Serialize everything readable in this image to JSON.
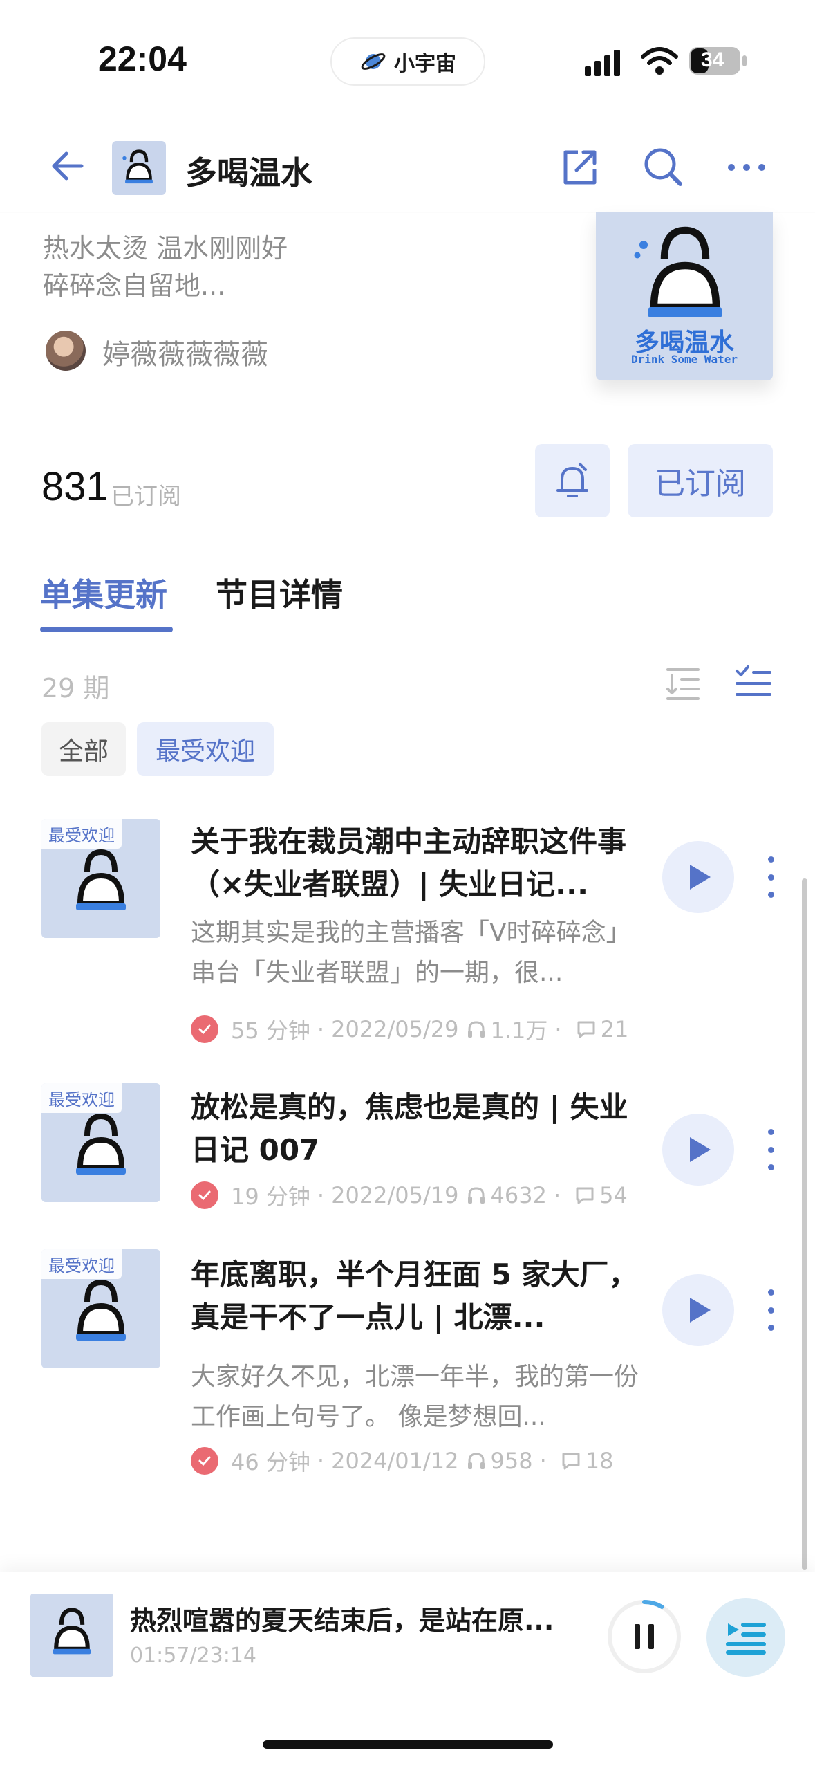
{
  "status_bar": {
    "time": "22:04",
    "app_pill_label": "小宇宙",
    "battery": "34"
  },
  "header": {
    "title": "多喝温水"
  },
  "podcast": {
    "description_lines": [
      "热水太烫 温水刚刚好",
      "碎碎念自留地..."
    ],
    "author": "婷薇薇薇薇薇",
    "cover_title": "多喝温水",
    "cover_subtitle": "Drink Some Water",
    "subscriber_count": "831",
    "subscriber_label": "已订阅",
    "subscribe_button": "已订阅"
  },
  "tabs": [
    {
      "label": "单集更新",
      "active": true
    },
    {
      "label": "节目详情",
      "active": false
    }
  ],
  "list": {
    "episode_count": "29 期",
    "filters": [
      {
        "label": "全部",
        "selected": false
      },
      {
        "label": "最受欢迎",
        "selected": true
      }
    ]
  },
  "episodes": [
    {
      "badge": "最受欢迎",
      "title": "关于我在裁员潮中主动辞职这件事（×失业者联盟）| 失业日记...",
      "description": "这期其实是我的主营播客「V时碎碎念」串台「失业者联盟」的一期，很...",
      "duration": "55 分钟",
      "date": "2022/05/29",
      "plays": "1.1万",
      "comments": "21"
    },
    {
      "badge": "最受欢迎",
      "title": "放松是真的，焦虑也是真的 | 失业日记 007",
      "description": "",
      "duration": "19 分钟",
      "date": "2022/05/19",
      "plays": "4632",
      "comments": "54"
    },
    {
      "badge": "最受欢迎",
      "title": "年底离职，半个月狂面 5 家大厂，真是干不了一点儿 | 北漂...",
      "description": "大家好久不见，北漂一年半，我的第一份工作画上句号了。 像是梦想回...",
      "duration": "46 分钟",
      "date": "2024/01/12",
      "plays": "958",
      "comments": "18"
    }
  ],
  "player": {
    "title": "热烈喧嚣的夏天结束后，是站在原...",
    "time": "01:57/23:14",
    "progress": 0.085
  },
  "colors": {
    "accent": "#5573c8",
    "accent_light": "#e9eefb",
    "check_red": "#ea6a72",
    "cover_bg": "#cfdaee"
  }
}
